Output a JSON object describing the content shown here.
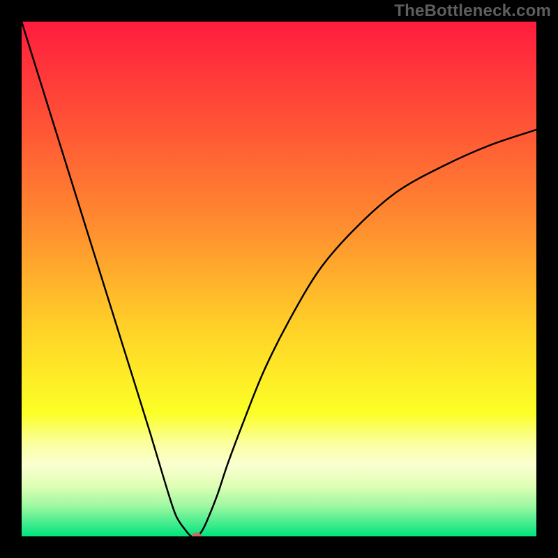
{
  "attribution": "TheBottleneck.com",
  "chart_data": {
    "type": "line",
    "title": "",
    "xlabel": "",
    "ylabel": "",
    "xlim": [
      0,
      100
    ],
    "ylim": [
      0,
      100
    ],
    "background_gradient": {
      "stops": [
        {
          "offset": 0,
          "color": "#ff1c3e"
        },
        {
          "offset": 20,
          "color": "#ff5336"
        },
        {
          "offset": 40,
          "color": "#ff8e2f"
        },
        {
          "offset": 60,
          "color": "#ffd328"
        },
        {
          "offset": 76,
          "color": "#fcff26"
        },
        {
          "offset": 82,
          "color": "#faffa0"
        },
        {
          "offset": 86,
          "color": "#fbffd0"
        },
        {
          "offset": 90,
          "color": "#e1ffb7"
        },
        {
          "offset": 94,
          "color": "#a0f8a2"
        },
        {
          "offset": 100,
          "color": "#00e47e"
        }
      ]
    },
    "series": [
      {
        "name": "bottleneck-curve",
        "x": [
          0,
          5,
          10,
          15,
          20,
          25,
          28,
          30,
          32,
          33,
          34,
          35,
          36,
          38,
          40,
          43,
          47,
          52,
          58,
          65,
          73,
          82,
          91,
          100
        ],
        "y": [
          100,
          84,
          68,
          52,
          36,
          20,
          10,
          4,
          1,
          0,
          0,
          1,
          3,
          8,
          14,
          22,
          32,
          42,
          52,
          60,
          67,
          72,
          76,
          79
        ]
      }
    ],
    "marker": {
      "x": 34,
      "y": 0,
      "color": "#cd6a5d"
    }
  }
}
